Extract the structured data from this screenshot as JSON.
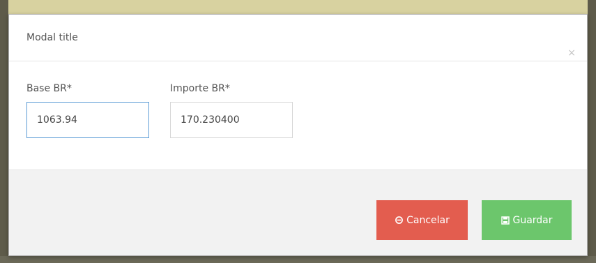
{
  "modal": {
    "title": "Modal title",
    "close_glyph": "×"
  },
  "form": {
    "base": {
      "label": "Base BR*",
      "value": "1063.94"
    },
    "importe": {
      "label": "Importe BR*",
      "value": "170.230400"
    }
  },
  "footer": {
    "cancel_label": "Cancelar",
    "save_label": "Guardar",
    "cancel_icon": "ban-icon",
    "save_icon": "floppy-disk-icon"
  },
  "colors": {
    "cancel_bg": "#e35d4f",
    "save_bg": "#6cc66c",
    "focus_border": "#5b9bd5"
  }
}
